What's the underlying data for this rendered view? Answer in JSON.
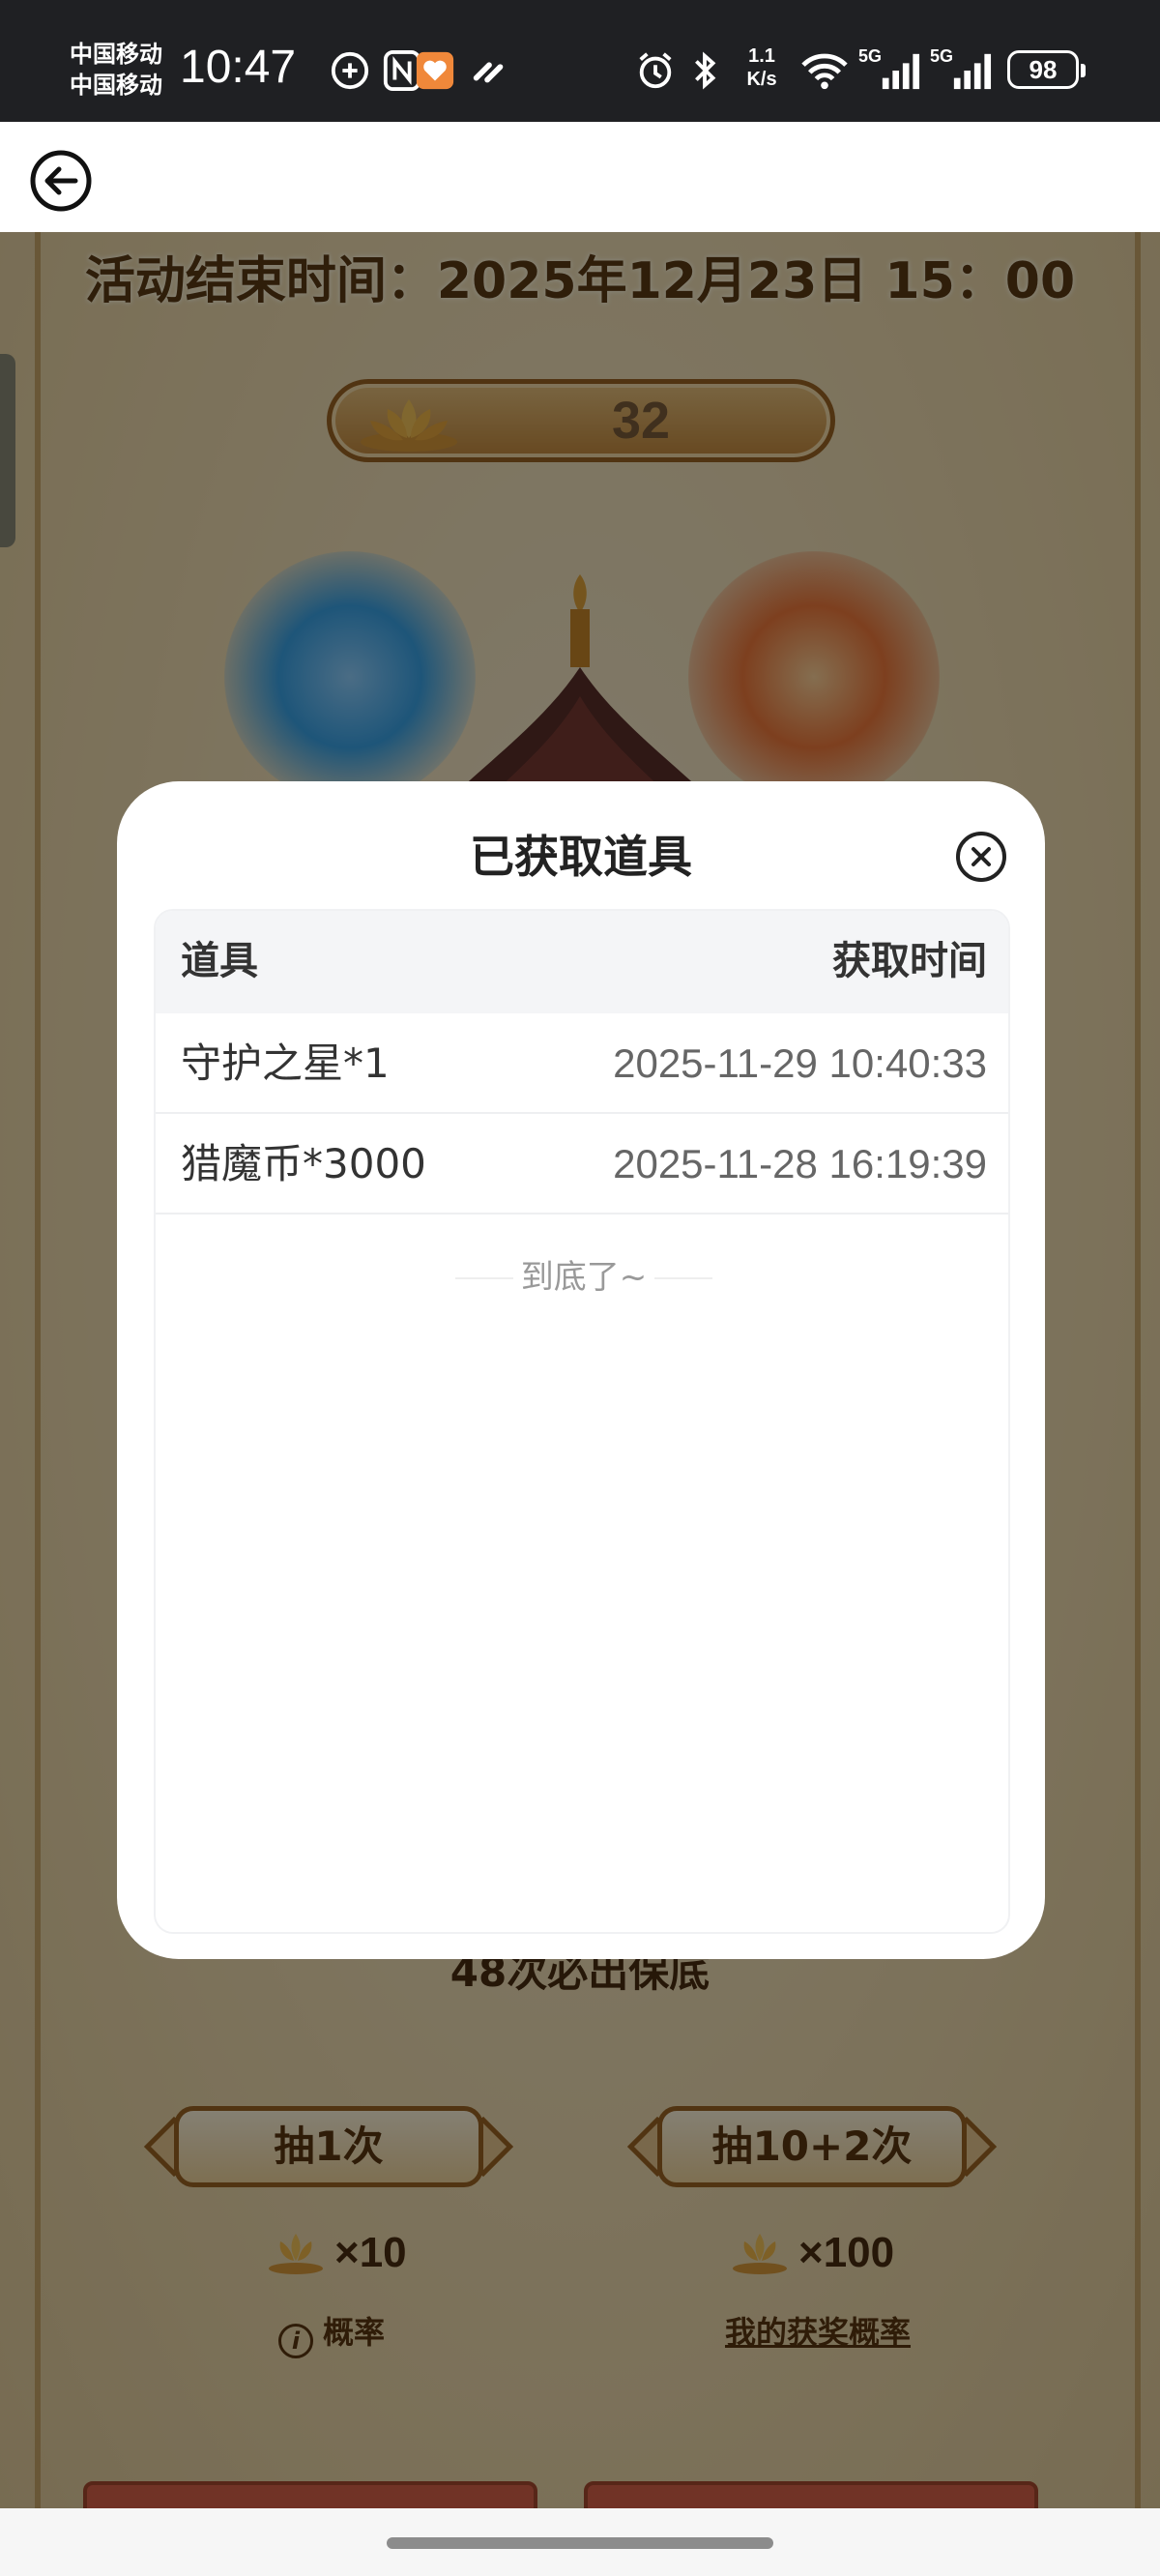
{
  "status_bar": {
    "carrier1": "中国移动",
    "carrier2": "中国移动",
    "time": "10:47",
    "net_speed_top": "1.1",
    "net_speed_unit": "K/s",
    "signal1_label": "5G",
    "signal2_label": "5G",
    "battery": "98"
  },
  "nav": {
    "back_icon": "back-arrow-icon"
  },
  "game": {
    "event_end": "活动结束时间：2025年12月23日 15：00",
    "lotus_count": "32",
    "guarantee": "48次必出保底",
    "draw_once": "抽1次",
    "draw_ten": "抽10+2次",
    "cost_once": "×10",
    "cost_ten": "×100",
    "probability": "概率",
    "my_probability": "我的获奖概率"
  },
  "modal": {
    "title": "已获取道具",
    "close_icon": "close-circle-icon",
    "columns": [
      "道具",
      "获取时间"
    ],
    "rows": [
      {
        "item": "守护之星*1",
        "time": "2025-11-29 10:40:33"
      },
      {
        "item": "猎魔币*3000",
        "time": "2025-11-28 16:19:39"
      }
    ],
    "end_note": "到底了~"
  }
}
